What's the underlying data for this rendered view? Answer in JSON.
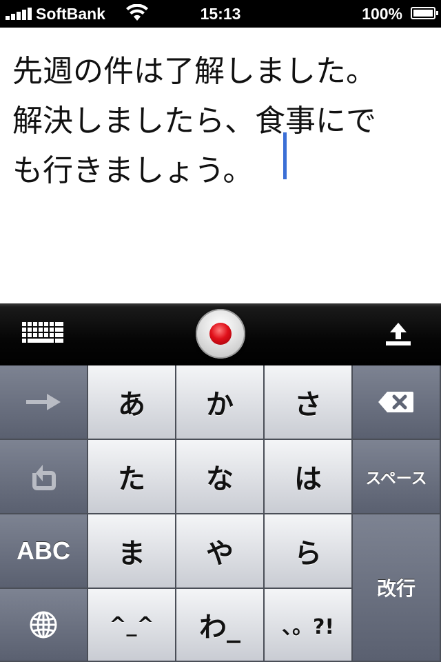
{
  "status_bar": {
    "carrier": "SoftBank",
    "time": "15:13",
    "battery_percent": "100%"
  },
  "note": {
    "lines": [
      "先週の件は了解しました。",
      "解決しましたら、食事にで",
      "も行きましょう。"
    ]
  },
  "dictation_toolbar": {
    "icons": [
      "keyboard-icon",
      "record-icon",
      "upload-icon"
    ],
    "record_color": "#e0101a"
  },
  "keyboard": {
    "keys": {
      "next": "→",
      "undo": "↺",
      "abc": "ABC",
      "globe": "globe",
      "a": "あ",
      "ka": "か",
      "sa": "さ",
      "ta": "た",
      "na": "な",
      "ha": "は",
      "ma": "ま",
      "ya": "や",
      "ra": "ら",
      "emoticon": "^_^",
      "wa": "わ_",
      "punct": "、。?!",
      "space": "スペース",
      "enter": "改行"
    }
  },
  "colors": {
    "cursor": "#3b6fd6",
    "key_light": "#e6e7eb",
    "key_dark": "#6a7080"
  }
}
